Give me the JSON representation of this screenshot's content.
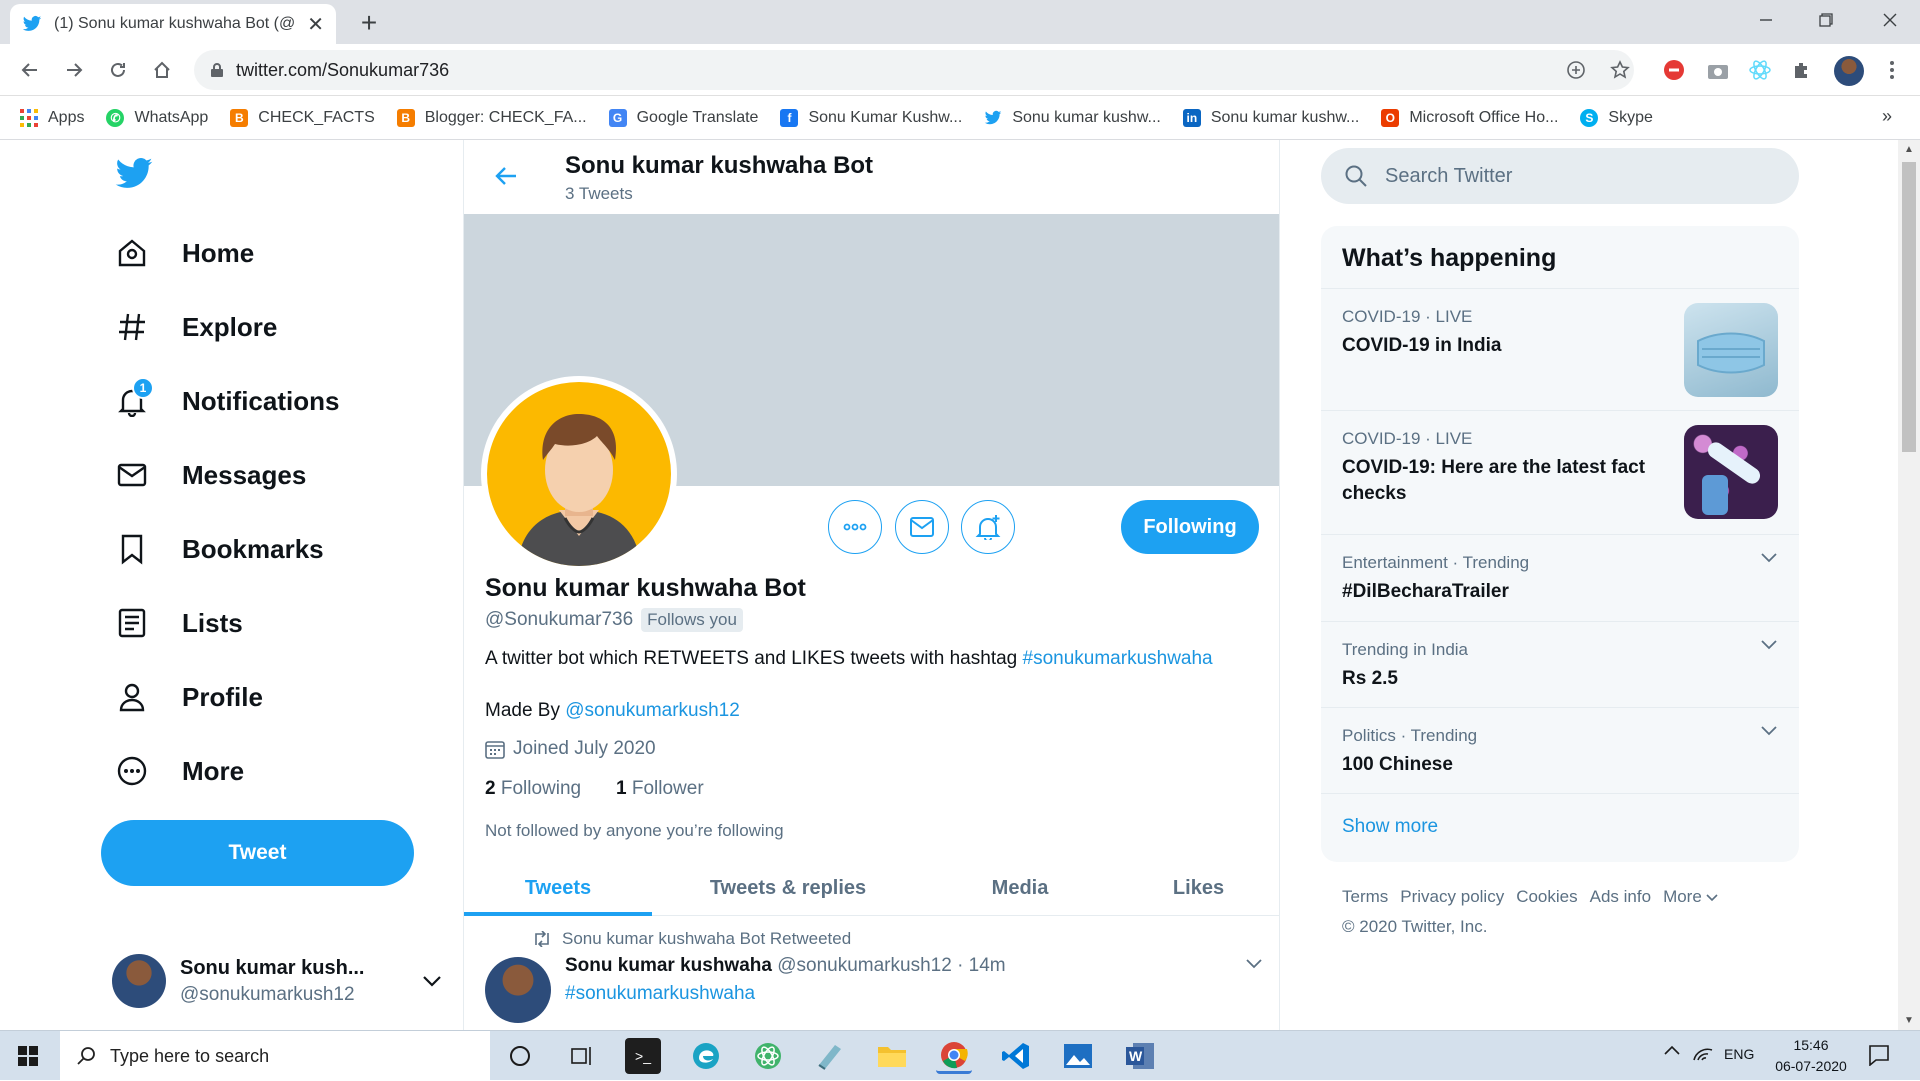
{
  "browser": {
    "tab_title": "(1) Sonu kumar kushwaha Bot (@",
    "url": "twitter.com/Sonukumar736",
    "bookmarks": [
      {
        "label": "Apps",
        "icon": "apps-grid-icon",
        "color": "#ea4335"
      },
      {
        "label": "WhatsApp",
        "icon": "whatsapp-icon",
        "color": "#25d366"
      },
      {
        "label": "CHECK_FACTS",
        "icon": "blogger-icon",
        "color": "#f57d00"
      },
      {
        "label": "Blogger: CHECK_FA...",
        "icon": "blogger-icon",
        "color": "#f57d00"
      },
      {
        "label": "Google Translate",
        "icon": "translate-icon",
        "color": "#4285f4"
      },
      {
        "label": "Sonu Kumar Kushw...",
        "icon": "facebook-icon",
        "color": "#1877f2"
      },
      {
        "label": "Sonu kumar kushw...",
        "icon": "twitter-icon",
        "color": "#1da1f2"
      },
      {
        "label": "Sonu kumar kushw...",
        "icon": "linkedin-icon",
        "color": "#0a66c2"
      },
      {
        "label": "Microsoft Office Ho...",
        "icon": "office-icon",
        "color": "#eb3c00"
      },
      {
        "label": "Skype",
        "icon": "skype-icon",
        "color": "#00aff0"
      }
    ]
  },
  "sidebar": {
    "items": [
      {
        "label": "Home",
        "icon": "home-icon"
      },
      {
        "label": "Explore",
        "icon": "hashtag-icon"
      },
      {
        "label": "Notifications",
        "icon": "bell-icon",
        "badge": "1"
      },
      {
        "label": "Messages",
        "icon": "envelope-icon"
      },
      {
        "label": "Bookmarks",
        "icon": "bookmark-icon"
      },
      {
        "label": "Lists",
        "icon": "list-icon"
      },
      {
        "label": "Profile",
        "icon": "person-icon"
      },
      {
        "label": "More",
        "icon": "more-circle-icon"
      }
    ],
    "tweet_button": "Tweet",
    "account": {
      "name": "Sonu kumar kush...",
      "handle": "@sonukumarkush12"
    }
  },
  "profile": {
    "header_name": "Sonu kumar kushwaha Bot",
    "header_count": "3 Tweets",
    "name": "Sonu kumar kushwaha Bot",
    "handle": "@Sonukumar736",
    "follows_you": "Follows you",
    "bio_text": "A twitter bot which RETWEETS and LIKES tweets with hashtag ",
    "bio_hashtag": "#sonukumarkushwaha",
    "made_by_label": "Made By ",
    "made_by_link": "@sonukumarkush12",
    "joined": "Joined July 2020",
    "following_count": "2",
    "following_label": "Following",
    "followers_count": "1",
    "followers_label": "Follower",
    "not_followed": "Not followed by anyone you’re following",
    "follow_button": "Following"
  },
  "tabs": [
    "Tweets",
    "Tweets & replies",
    "Media",
    "Likes"
  ],
  "tweet": {
    "retweet_note": "Sonu kumar kushwaha Bot Retweeted",
    "author": "Sonu kumar kushwaha",
    "handle": "@sonukumarkush12",
    "time": "14m",
    "text": "#sonukumarkushwaha"
  },
  "search": {
    "placeholder": "Search Twitter"
  },
  "trends": {
    "title": "What’s happening",
    "items": [
      {
        "category": "COVID-19 · LIVE",
        "name": "COVID-19 in India"
      },
      {
        "category": "COVID-19 · LIVE",
        "name": "COVID-19: Here are the latest fact checks"
      },
      {
        "category": "Entertainment · Trending",
        "name": "#DilBecharaTrailer"
      },
      {
        "category": "Trending in India",
        "name": "Rs 2.5"
      },
      {
        "category": "Politics · Trending",
        "name": "100 Chinese"
      }
    ],
    "show_more": "Show more"
  },
  "footer": {
    "links": [
      "Terms",
      "Privacy policy",
      "Cookies",
      "Ads info",
      "More"
    ],
    "copyright": "© 2020 Twitter, Inc."
  },
  "taskbar": {
    "search_placeholder": "Type here to search",
    "lang": "ENG",
    "time": "15:46",
    "date": "06-07-2020"
  },
  "colors": {
    "accent": "#1da1f2",
    "banner": "#ccd6dd",
    "avatar_bg": "#fcb900"
  }
}
